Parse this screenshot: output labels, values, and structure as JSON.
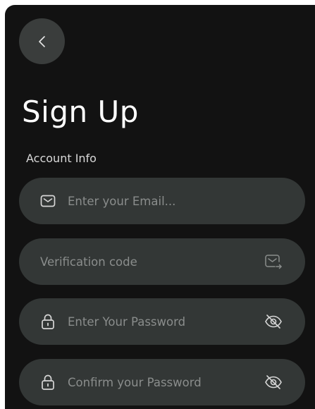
{
  "header": {
    "back_icon": "chevron-left-icon",
    "title": "Sign Up"
  },
  "section": {
    "label": "Account Info"
  },
  "fields": {
    "email": {
      "value": "",
      "placeholder": "Enter your Email...",
      "icon": "mail-icon"
    },
    "verification_code": {
      "value": "",
      "placeholder": "Verification code",
      "icon": "send-code-icon"
    },
    "password": {
      "value": "",
      "placeholder": "Enter Your Password",
      "icon": "lock-icon",
      "toggle_icon": "eye-off-icon"
    },
    "confirm_password": {
      "value": "",
      "placeholder": "Confirm your Password",
      "icon": "lock-icon",
      "toggle_icon": "eye-off-icon"
    }
  },
  "colors": {
    "background": "#121212",
    "field": "#333736",
    "back_button": "#3a3d3c",
    "placeholder": "#8a8d8c",
    "text": "#ffffff"
  }
}
